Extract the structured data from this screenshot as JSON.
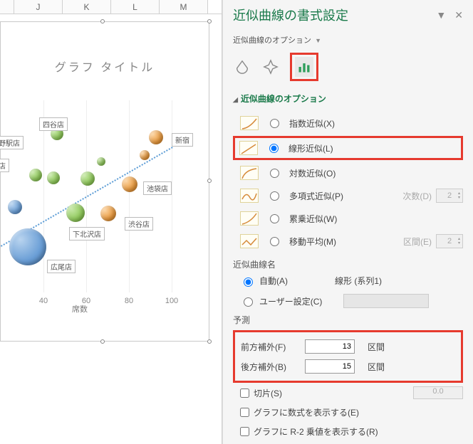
{
  "columns": [
    "J",
    "K",
    "L",
    "M"
  ],
  "chart": {
    "title": "グラフ タイトル",
    "x_axis_label": "席数",
    "x_ticks": [
      40,
      60,
      80,
      100
    ]
  },
  "chart_data": {
    "type": "scatter",
    "xlabel": "席数",
    "title": "グラフ タイトル",
    "x_ticks": [
      40,
      60,
      80,
      100
    ],
    "points": [
      {
        "label": "広尾店",
        "x": 32,
        "y": 20,
        "series": "blue",
        "size": 52
      },
      {
        "label": "",
        "x": 28,
        "y": 35,
        "series": "blue",
        "size": 20
      },
      {
        "label": "町店",
        "x": 38,
        "y": 55,
        "series": "green",
        "size": 18
      },
      {
        "label": "下北沢店",
        "x": 50,
        "y": 40,
        "series": "green",
        "size": 26
      },
      {
        "label": "四谷店",
        "x": 44,
        "y": 82,
        "series": "green",
        "size": 18
      },
      {
        "label": "",
        "x": 56,
        "y": 55,
        "series": "green",
        "size": 20
      },
      {
        "label": "上野駅店",
        "x": 42,
        "y": 70,
        "series": "green",
        "size": 14
      },
      {
        "label": "",
        "x": 64,
        "y": 62,
        "series": "green",
        "size": 12
      },
      {
        "label": "渋谷店",
        "x": 76,
        "y": 42,
        "series": "orange",
        "size": 22
      },
      {
        "label": "池袋店",
        "x": 90,
        "y": 58,
        "series": "orange",
        "size": 22
      },
      {
        "label": "",
        "x": 92,
        "y": 70,
        "series": "orange",
        "size": 14
      },
      {
        "label": "新宿",
        "x": 96,
        "y": 80,
        "series": "orange",
        "size": 20
      }
    ],
    "trendline": {
      "type": "linear",
      "series": "系列1",
      "forward": 13,
      "backward": 15
    }
  },
  "pane": {
    "title": "近似曲線の書式設定",
    "subheader": "近似曲線のオプション",
    "section": "近似曲線のオプション",
    "types": {
      "exp": "指数近似(X)",
      "linear": "線形近似(L)",
      "log": "対数近似(O)",
      "poly": "多項式近似(P)",
      "power": "累乗近似(W)",
      "movavg": "移動平均(M)"
    },
    "degree_label": "次数(D)",
    "degree_value": "2",
    "period_label": "区間(E)",
    "period_value": "2",
    "name_section": "近似曲線名",
    "auto_label": "自動(A)",
    "auto_value": "線形 (系列1)",
    "user_label": "ユーザー設定(C)",
    "user_value": "",
    "forecast_section": "予測",
    "forward_label": "前方補外(F)",
    "forward_value": "13",
    "backward_label": "後方補外(B)",
    "backward_value": "15",
    "unit": "区間",
    "intercept_label": "切片(S)",
    "intercept_value": "0.0",
    "show_eq": "グラフに数式を表示する(E)",
    "show_r2": "グラフに R-2 乗値を表示する(R)"
  }
}
